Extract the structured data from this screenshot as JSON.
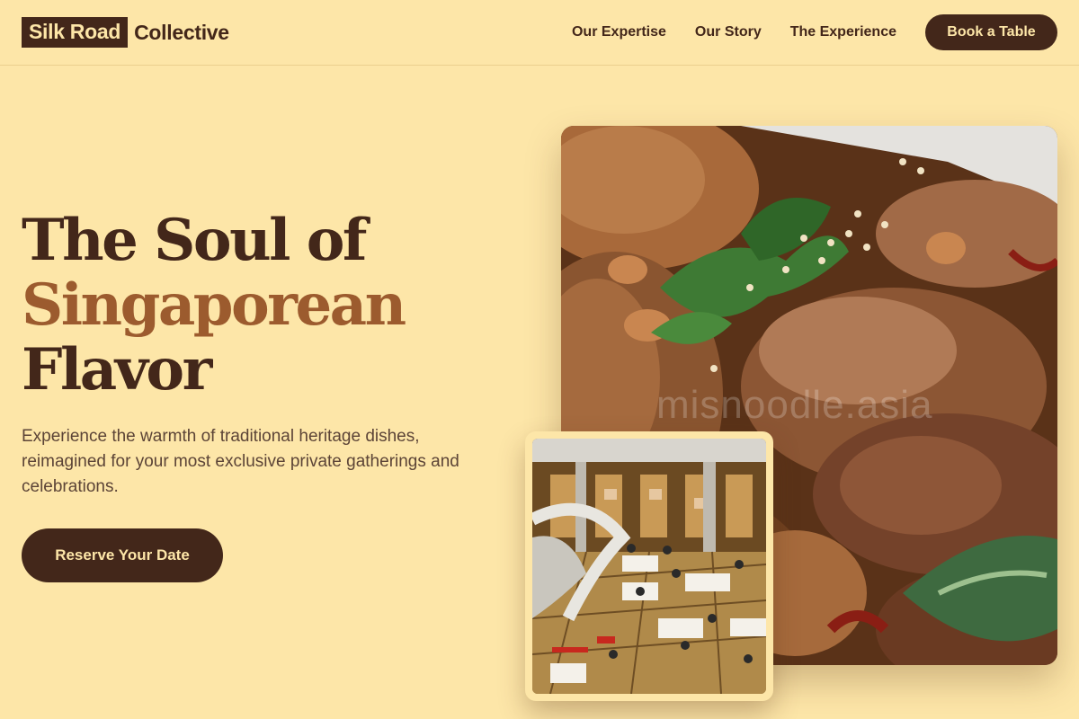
{
  "brand": {
    "box_text": "Silk Road",
    "text": "Collective"
  },
  "nav": {
    "links": [
      "Our Expertise",
      "Our Story",
      "The Experience"
    ],
    "cta": "Book a Table"
  },
  "hero": {
    "line1": "The Soul of",
    "line2": "Singaporean",
    "line3": "Flavor",
    "subtitle": "Experience the warmth of traditional heritage dishes, reimagined for your most exclusive private gatherings and celebrations.",
    "cta": "Reserve Your Date"
  },
  "images": {
    "main_alt": "Stir-fried beef with peanuts, sesame and cilantro",
    "main_watermark": "misnoodle.asia",
    "inset_alt": "Banquet dining hall interior"
  },
  "colors": {
    "background": "#FDE6A8",
    "primary": "#43271A",
    "accent": "#9C5B2E",
    "text_muted": "#5C4437"
  }
}
